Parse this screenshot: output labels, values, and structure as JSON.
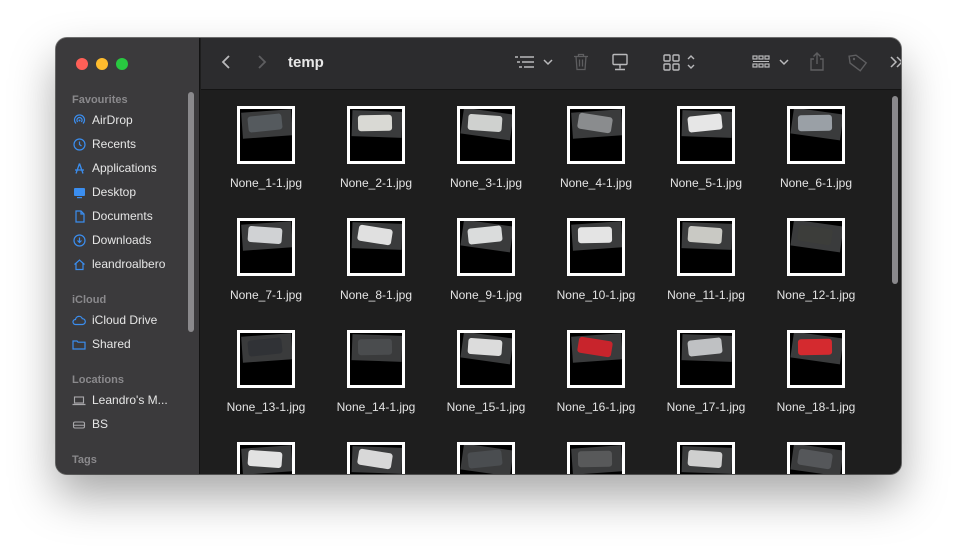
{
  "window": {
    "title": "temp"
  },
  "sidebar": {
    "sections": [
      {
        "label": "Favourites",
        "items": [
          {
            "label": "AirDrop",
            "icon": "airdrop-icon"
          },
          {
            "label": "Recents",
            "icon": "clock-icon"
          },
          {
            "label": "Applications",
            "icon": "applications-icon"
          },
          {
            "label": "Desktop",
            "icon": "desktop-icon"
          },
          {
            "label": "Documents",
            "icon": "document-icon"
          },
          {
            "label": "Downloads",
            "icon": "download-icon"
          },
          {
            "label": "leandroalbero",
            "icon": "home-icon"
          }
        ]
      },
      {
        "label": "iCloud",
        "items": [
          {
            "label": "iCloud Drive",
            "icon": "cloud-icon"
          },
          {
            "label": "Shared",
            "icon": "shared-folder-icon"
          }
        ]
      },
      {
        "label": "Locations",
        "items": [
          {
            "label": "Leandro's M...",
            "icon": "laptop-icon"
          },
          {
            "label": "BS",
            "icon": "drive-icon"
          }
        ]
      },
      {
        "label": "Tags",
        "items": []
      }
    ]
  },
  "toolbar": {
    "icons": [
      "back-icon",
      "forward-icon",
      "list-view-icon",
      "trash-icon",
      "connect-server-icon",
      "icon-view-icon",
      "group-icon",
      "share-icon",
      "tag-icon",
      "more-icon",
      "search-icon"
    ]
  },
  "files": [
    {
      "name": "None_1-1.jpg",
      "car": "#555a5e"
    },
    {
      "name": "None_2-1.jpg",
      "car": "#d9d9d4"
    },
    {
      "name": "None_3-1.jpg",
      "car": "#cfd1cf"
    },
    {
      "name": "None_4-1.jpg",
      "car": "#8a8c8e"
    },
    {
      "name": "None_5-1.jpg",
      "car": "#e6e6e6"
    },
    {
      "name": "None_6-1.jpg",
      "car": "#9aa0a6"
    },
    {
      "name": "None_7-1.jpg",
      "car": "#d0d2d4"
    },
    {
      "name": "None_8-1.jpg",
      "car": "#e0e0e0"
    },
    {
      "name": "None_9-1.jpg",
      "car": "#dadcdc"
    },
    {
      "name": "None_10-1.jpg",
      "car": "#e4e4e4"
    },
    {
      "name": "None_11-1.jpg",
      "car": "#c9c9c4"
    },
    {
      "name": "None_12-1.jpg",
      "car": "#3c3d3a"
    },
    {
      "name": "None_13-1.jpg",
      "car": "#303236"
    },
    {
      "name": "None_14-1.jpg",
      "car": "#4a4c4e"
    },
    {
      "name": "None_15-1.jpg",
      "car": "#dcdcdc"
    },
    {
      "name": "None_16-1.jpg",
      "car": "#c8242c"
    },
    {
      "name": "None_17-1.jpg",
      "car": "#bfc1c3"
    },
    {
      "name": "None_18-1.jpg",
      "car": "#d42a2f"
    },
    {
      "name": "",
      "car": "#e2e2e2"
    },
    {
      "name": "",
      "car": "#d8d8d8"
    },
    {
      "name": "",
      "car": "#4a4d50"
    },
    {
      "name": "",
      "car": "#58595a"
    },
    {
      "name": "",
      "car": "#cfcfcf"
    },
    {
      "name": "",
      "car": "#55575a"
    }
  ]
}
